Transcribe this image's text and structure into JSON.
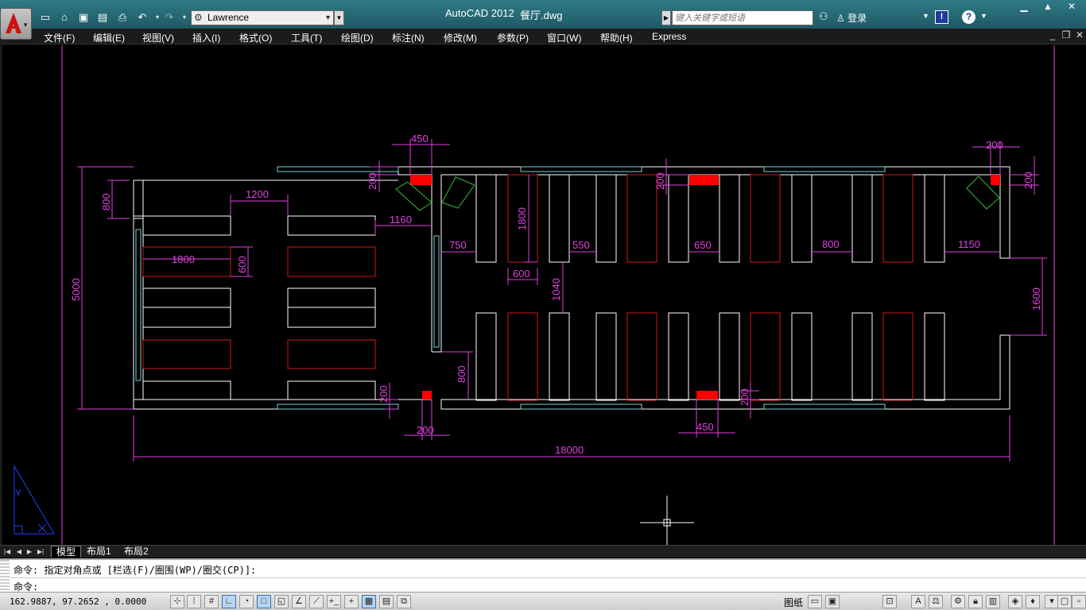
{
  "titlebar": {
    "workspace": "Lawrence",
    "app_title": "AutoCAD 2012",
    "file_name": "餐厅.dwg",
    "search_placeholder": "键入关键字或短语",
    "login": "登录"
  },
  "menu": [
    "文件(F)",
    "编辑(E)",
    "视图(V)",
    "插入(I)",
    "格式(O)",
    "工具(T)",
    "绘图(D)",
    "标注(N)",
    "修改(M)",
    "参数(P)",
    "窗口(W)",
    "帮助(H)",
    "Express"
  ],
  "dimensions": {
    "d450_top": "450",
    "d200_top_left": "200",
    "d800_left": "800",
    "d1200": "1200",
    "d1160": "1160",
    "d1800_table": "1800",
    "d600_table": "600",
    "d5000": "5000",
    "d1800_vert": "1800",
    "d200_top_mid": "200",
    "d750": "750",
    "d550": "550",
    "d650": "650",
    "d800_mid": "800",
    "d1150": "1150",
    "d600_bottom": "600",
    "d1040": "1040",
    "d200_top_right": "200",
    "d200_right_vert": "200",
    "d1600": "1600",
    "d800_bottom_left": "800",
    "d200_bottom_left_vert": "200",
    "d200_bottom_left": "200",
    "d450_bottom": "450",
    "d200_bottom_mid": "200",
    "d18000": "18000"
  },
  "ucs_label": "Y",
  "tabs": [
    "模型",
    "布局1",
    "布局2"
  ],
  "command": {
    "history": "命令: 指定对角点或 [栏选(F)/圈围(WP)/圈交(CP)]:",
    "prompt": "命令:"
  },
  "status": {
    "coords": "162.9887, 97.2652 , 0.0000",
    "paper": "图纸"
  },
  "colors": {
    "wall": "#ffffff",
    "dimension": "#e040e0",
    "window": "#7ad0d0",
    "highlight": "#ff0000",
    "table_red": "#d01818",
    "plant": "#30c030",
    "ucs": "#2040ff"
  }
}
